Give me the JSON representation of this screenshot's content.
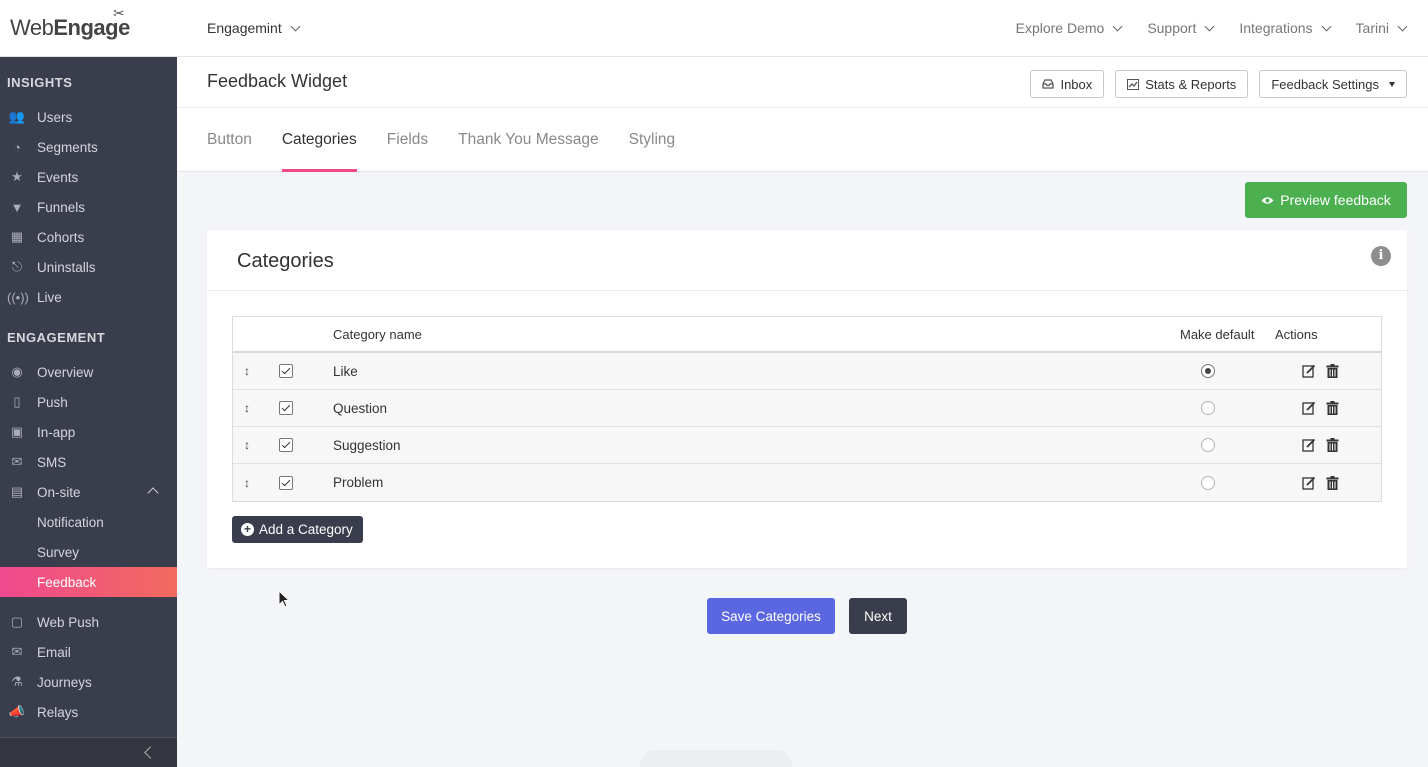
{
  "brand": {
    "logo_web": "Web",
    "logo_engage": "Engage"
  },
  "topbar": {
    "project": "Engagemint",
    "nav": [
      "Explore Demo",
      "Support",
      "Integrations",
      "Tarini"
    ]
  },
  "sidebar": {
    "insights_label": "INSIGHTS",
    "insights": [
      {
        "label": "Users",
        "icon": "users-icon"
      },
      {
        "label": "Segments",
        "icon": "segments-icon"
      },
      {
        "label": "Events",
        "icon": "events-icon"
      },
      {
        "label": "Funnels",
        "icon": "funnel-icon"
      },
      {
        "label": "Cohorts",
        "icon": "cohorts-icon"
      },
      {
        "label": "Uninstalls",
        "icon": "uninstall-icon"
      },
      {
        "label": "Live",
        "icon": "live-icon"
      }
    ],
    "engagement_label": "ENGAGEMENT",
    "engagement": [
      {
        "label": "Overview",
        "icon": "eye-icon"
      },
      {
        "label": "Push",
        "icon": "push-icon"
      },
      {
        "label": "In-app",
        "icon": "inapp-icon"
      },
      {
        "label": "SMS",
        "icon": "sms-icon"
      },
      {
        "label": "On-site",
        "icon": "onsite-icon"
      }
    ],
    "onsite_sub": [
      "Notification",
      "Survey",
      "Feedback"
    ],
    "more": [
      {
        "label": "Web Push",
        "icon": "webpush-icon"
      },
      {
        "label": "Email",
        "icon": "email-icon"
      },
      {
        "label": "Journeys",
        "icon": "journeys-icon"
      },
      {
        "label": "Relays",
        "icon": "relays-icon"
      }
    ]
  },
  "header": {
    "title": "Feedback Widget",
    "buttons": {
      "inbox": "Inbox",
      "stats": "Stats & Reports",
      "settings": "Feedback Settings"
    },
    "tabs": [
      "Button",
      "Categories",
      "Fields",
      "Thank You Message",
      "Styling"
    ],
    "active_tab": "Categories"
  },
  "preview_label": "Preview feedback",
  "card": {
    "title": "Categories",
    "columns": {
      "name": "Category name",
      "default": "Make default",
      "actions": "Actions"
    },
    "rows": [
      {
        "name": "Like",
        "checked": true,
        "default": true
      },
      {
        "name": "Question",
        "checked": true,
        "default": false
      },
      {
        "name": "Suggestion",
        "checked": true,
        "default": false
      },
      {
        "name": "Problem",
        "checked": true,
        "default": false
      }
    ],
    "add_label": "Add a Category"
  },
  "footer": {
    "save_label": "Save Categories",
    "next_label": "Next"
  },
  "colors": {
    "accent": "#ee4a8a",
    "primary": "#5b67e0",
    "success": "#4caf50",
    "dark": "#3a3d4c"
  }
}
